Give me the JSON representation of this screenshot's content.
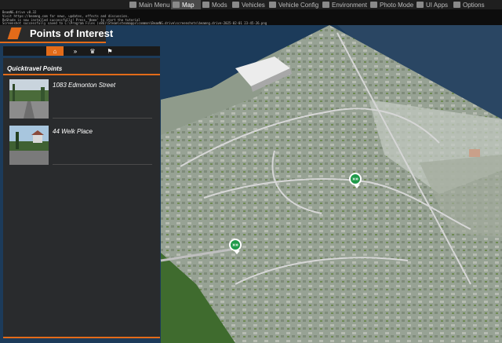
{
  "console": {
    "lines": [
      "BeamNG.drive v0.32",
      "Visit https://beamng.com for news, updates, effects and discussion.",
      "ReShade is now installed successfully! Press 'Home' to start the tutorial",
      "Screenshot successfully saved to C:\\Program Files (x86)\\Steam\\steamapps\\common\\BeamNG.drive\\screenshots\\beamng.drive-2025-02-01 23-45-26.png"
    ]
  },
  "topnav": {
    "items": [
      {
        "label": "Main Menu",
        "icon": "home-icon"
      },
      {
        "label": "Map",
        "icon": "map-icon",
        "active": true
      },
      {
        "label": "Mods",
        "icon": "mods-icon"
      },
      {
        "label": "Vehicles",
        "icon": "car-icon"
      },
      {
        "label": "Vehicle Config",
        "icon": "wrench-icon"
      },
      {
        "label": "Environment",
        "icon": "cloud-icon"
      },
      {
        "label": "Photo Mode",
        "icon": "camera-icon"
      },
      {
        "label": "UI Apps",
        "icon": "apps-icon"
      },
      {
        "label": "Options",
        "icon": "gear-icon"
      }
    ]
  },
  "header": {
    "title": "Points of Interest"
  },
  "tabs": [
    {
      "icon": "home-icon",
      "glyph": "⌂",
      "active": true
    },
    {
      "icon": "fast-forward-icon",
      "glyph": "»"
    },
    {
      "icon": "trophy-icon",
      "glyph": "♛"
    },
    {
      "icon": "checkered-flag-icon",
      "glyph": "⚑"
    }
  ],
  "panel": {
    "title": "Quicktravel Points",
    "items": [
      {
        "name": "1083 Edmonton Street"
      },
      {
        "name": "44 Welk Place"
      }
    ]
  },
  "map": {
    "pins": [
      {
        "name": "quicktravel-pin-1",
        "glyph": "»»"
      },
      {
        "name": "quicktravel-pin-2",
        "glyph": "»»"
      }
    ],
    "colors": {
      "accent": "#e36b19",
      "pin": "#1f9a4a",
      "water": "#1c3b5a",
      "ground": "#98a395"
    }
  }
}
